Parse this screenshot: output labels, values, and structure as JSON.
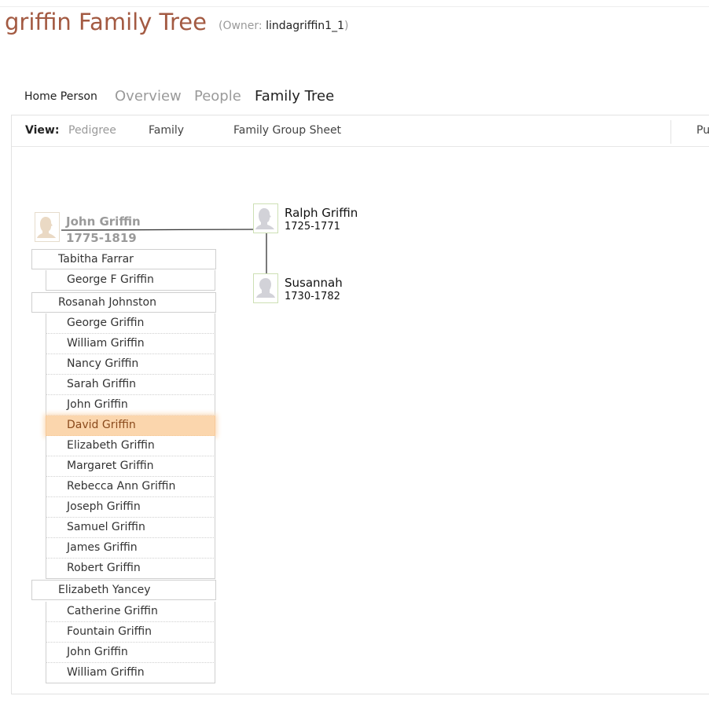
{
  "header": {
    "title": "griffin Family Tree",
    "owner_label": "(Owner: ",
    "owner_name": "lindagriffin1_1",
    "owner_close": ")"
  },
  "nav": {
    "home_person": "Home Person",
    "overview": "Overview",
    "people": "People",
    "family_tree": "Family Tree"
  },
  "viewbar": {
    "label": "View:",
    "pedigree": "Pedigree",
    "family": "Family",
    "family_group_sheet": "Family Group Sheet",
    "truncated_right": "Pu"
  },
  "home_person": {
    "name": "John Griffin",
    "dates": "1775-1819"
  },
  "parents": [
    {
      "name": "Ralph Griffin",
      "dates": "1725-1771"
    },
    {
      "name": "Susannah",
      "dates": "1730-1782"
    }
  ],
  "spouses": [
    {
      "name": "Tabitha Farrar",
      "children": [
        "George F Griffin"
      ]
    },
    {
      "name": "Rosanah Johnston",
      "children": [
        "George Griffin",
        "William Griffin",
        "Nancy Griffin",
        "Sarah Griffin",
        "John Griffin",
        "David Griffin",
        "Elizabeth Griffin",
        "Margaret Griffin",
        "Rebecca Ann Griffin",
        "Joseph Griffin",
        "Samuel Griffin",
        "James Griffin",
        "Robert Griffin"
      ]
    },
    {
      "name": "Elizabeth Yancey",
      "children": [
        "Catherine Griffin",
        "Fountain Griffin",
        "John Griffin",
        "William Griffin"
      ]
    }
  ],
  "highlighted_child": "David Griffin",
  "colors": {
    "title": "#a35a42",
    "highlight": "#fbd6ad",
    "silhouette_border": "#cde0b4"
  },
  "icons": {
    "person": "person-silhouette-icon"
  }
}
